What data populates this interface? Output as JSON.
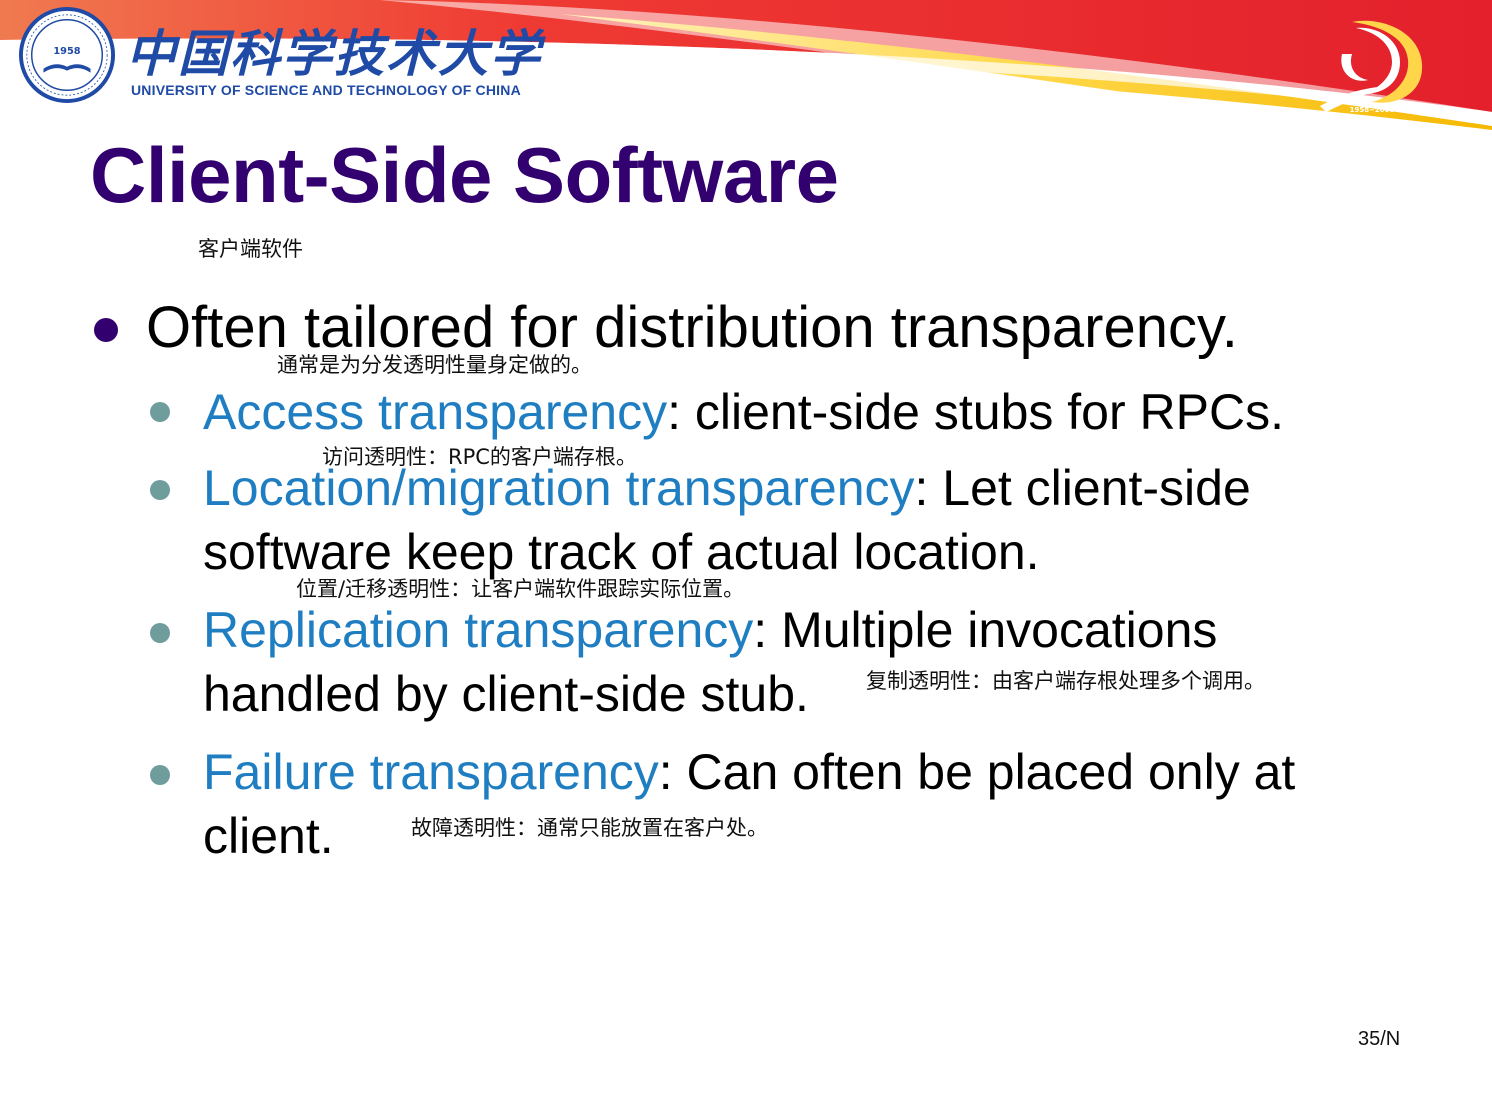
{
  "header": {
    "school_name_cn": "中国科学技术大学",
    "school_name_en": "UNIVERSITY OF SCIENCE AND TECHNOLOGY OF CHINA",
    "seal_year": "1958",
    "anniversary_years": "1958~2008",
    "banner_color": "#e8252f",
    "brand_color": "#1f4aa6"
  },
  "slide": {
    "title": "Client-Side Software",
    "title_note": "客户端软件",
    "title_color": "#33006f",
    "bullets": [
      {
        "text": "Often tailored for distribution transparency.",
        "note": "通常是为分发透明性量身定做的。"
      }
    ],
    "sub_bullets": [
      {
        "term": "Access transparency",
        "rest_line1": ": client-side stubs for RPCs.",
        "rest_line2": "",
        "note": "访问透明性：RPC的客户端存根。"
      },
      {
        "term": "Location/migration transparency",
        "rest_line1": ": Let client-side",
        "rest_line2": "software keep track of actual location.",
        "note": "位置/迁移透明性：让客户端软件跟踪实际位置。"
      },
      {
        "term": "Replication transparency",
        "rest_line1": ": Multiple invocations",
        "rest_line2": "handled by client-side stub.",
        "note": "复制透明性：由客户端存根处理多个调用。"
      },
      {
        "term": "Failure transparency",
        "rest_line1": ": Can often be placed only at",
        "rest_line2": "client.",
        "note": "故障透明性：通常只能放置在客户处。"
      }
    ],
    "term_color": "#1f7ec2",
    "page_number": "35/N"
  }
}
